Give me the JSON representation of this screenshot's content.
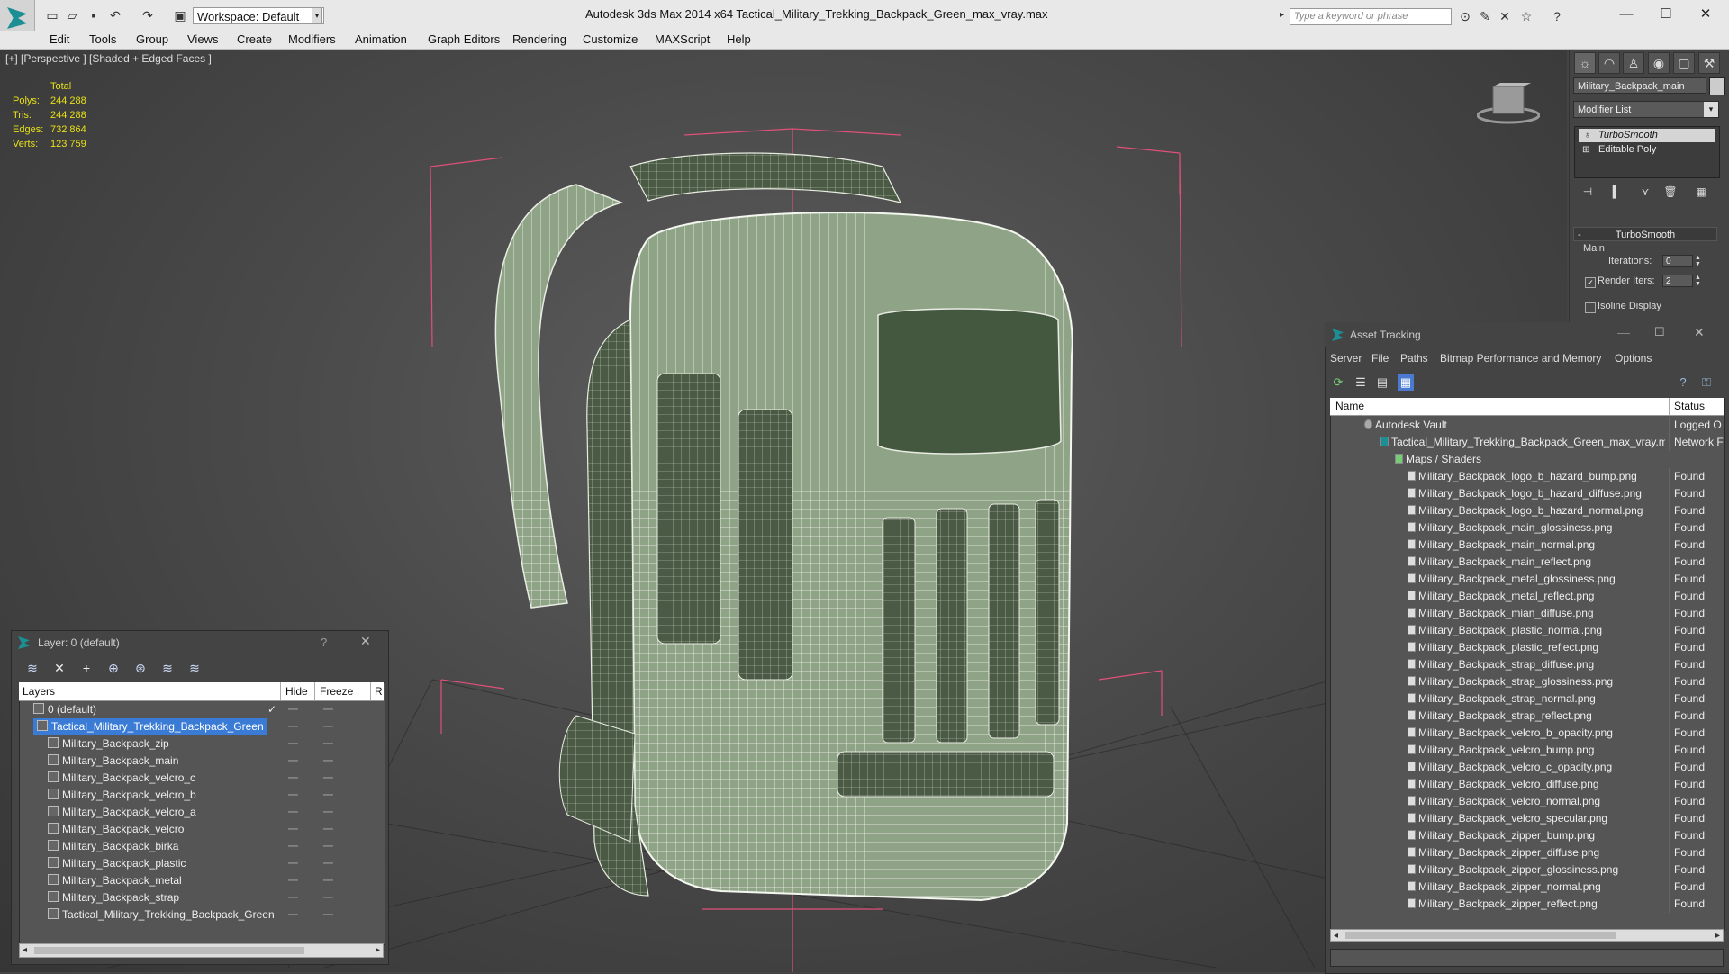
{
  "app": {
    "title": "Autodesk 3ds Max  2014 x64      Tactical_Military_Trekking_Backpack_Green_max_vray.max",
    "workspace": "Workspace: Default",
    "search_placeholder": "Type a keyword or phrase"
  },
  "menu": [
    "Edit",
    "Tools",
    "Group",
    "Views",
    "Create",
    "Modifiers",
    "Animation",
    "Graph Editors",
    "Rendering",
    "Customize",
    "MAXScript",
    "Help"
  ],
  "viewport": {
    "label": "[+] [Perspective ] [Shaded + Edged Faces ]",
    "stats_header": "Total",
    "stats": [
      {
        "label": "Polys:",
        "value": "244 288"
      },
      {
        "label": "Tris:",
        "value": "244 288"
      },
      {
        "label": "Edges:",
        "value": "732 864"
      },
      {
        "label": "Verts:",
        "value": "123 759"
      }
    ]
  },
  "command_panel": {
    "object_name": "Military_Backpack_main",
    "modifier_list": "Modifier List",
    "stack": [
      "TurboSmooth",
      "Editable Poly"
    ],
    "rollout_title": "TurboSmooth",
    "main_label": "Main",
    "iterations_label": "Iterations:",
    "iterations_value": "0",
    "render_iters_label": "Render Iters:",
    "render_iters_value": "2",
    "isoline_label": "Isoline Display"
  },
  "asset_tracking": {
    "title": "Asset Tracking",
    "menu": [
      "Server",
      "File",
      "Paths",
      "Bitmap Performance and Memory",
      "Options"
    ],
    "columns": {
      "name": "Name",
      "status": "Status"
    },
    "rows": [
      {
        "name": "Autodesk Vault",
        "status": "Logged O",
        "level": 0
      },
      {
        "name": "Tactical_Military_Trekking_Backpack_Green_max_vray.max",
        "status": "Network F",
        "level": 1
      },
      {
        "name": "Maps / Shaders",
        "status": "",
        "level": 2
      },
      {
        "name": "Military_Backpack_logo_b_hazard_bump.png",
        "status": "Found",
        "level": 3
      },
      {
        "name": "Military_Backpack_logo_b_hazard_diffuse.png",
        "status": "Found",
        "level": 3
      },
      {
        "name": "Military_Backpack_logo_b_hazard_normal.png",
        "status": "Found",
        "level": 3
      },
      {
        "name": "Military_Backpack_main_glossiness.png",
        "status": "Found",
        "level": 3
      },
      {
        "name": "Military_Backpack_main_normal.png",
        "status": "Found",
        "level": 3
      },
      {
        "name": "Military_Backpack_main_reflect.png",
        "status": "Found",
        "level": 3
      },
      {
        "name": "Military_Backpack_metal_glossiness.png",
        "status": "Found",
        "level": 3
      },
      {
        "name": "Military_Backpack_metal_reflect.png",
        "status": "Found",
        "level": 3
      },
      {
        "name": "Military_Backpack_mian_diffuse.png",
        "status": "Found",
        "level": 3
      },
      {
        "name": "Military_Backpack_plastic_normal.png",
        "status": "Found",
        "level": 3
      },
      {
        "name": "Military_Backpack_plastic_reflect.png",
        "status": "Found",
        "level": 3
      },
      {
        "name": "Military_Backpack_strap_diffuse.png",
        "status": "Found",
        "level": 3
      },
      {
        "name": "Military_Backpack_strap_glossiness.png",
        "status": "Found",
        "level": 3
      },
      {
        "name": "Military_Backpack_strap_normal.png",
        "status": "Found",
        "level": 3
      },
      {
        "name": "Military_Backpack_strap_reflect.png",
        "status": "Found",
        "level": 3
      },
      {
        "name": "Military_Backpack_velcro_b_opacity.png",
        "status": "Found",
        "level": 3
      },
      {
        "name": "Military_Backpack_velcro_bump.png",
        "status": "Found",
        "level": 3
      },
      {
        "name": "Military_Backpack_velcro_c_opacity.png",
        "status": "Found",
        "level": 3
      },
      {
        "name": "Military_Backpack_velcro_diffuse.png",
        "status": "Found",
        "level": 3
      },
      {
        "name": "Military_Backpack_velcro_normal.png",
        "status": "Found",
        "level": 3
      },
      {
        "name": "Military_Backpack_velcro_specular.png",
        "status": "Found",
        "level": 3
      },
      {
        "name": "Military_Backpack_zipper_bump.png",
        "status": "Found",
        "level": 3
      },
      {
        "name": "Military_Backpack_zipper_diffuse.png",
        "status": "Found",
        "level": 3
      },
      {
        "name": "Military_Backpack_zipper_glossiness.png",
        "status": "Found",
        "level": 3
      },
      {
        "name": "Military_Backpack_zipper_normal.png",
        "status": "Found",
        "level": 3
      },
      {
        "name": "Military_Backpack_zipper_reflect.png",
        "status": "Found",
        "level": 3
      }
    ]
  },
  "layer_window": {
    "title": "Layer: 0 (default)",
    "help": "?",
    "columns": {
      "layers": "Layers",
      "hide": "Hide",
      "freeze": "Freeze",
      "r": "R"
    },
    "rows": [
      {
        "name": "0 (default)",
        "level": 0,
        "selected": false,
        "check": "✓"
      },
      {
        "name": "Tactical_Military_Trekking_Backpack_Green",
        "level": 0,
        "selected": true,
        "check": ""
      },
      {
        "name": "Military_Backpack_zip",
        "level": 1,
        "selected": false,
        "check": ""
      },
      {
        "name": "Military_Backpack_main",
        "level": 1,
        "selected": false,
        "check": ""
      },
      {
        "name": "Military_Backpack_velcro_c",
        "level": 1,
        "selected": false,
        "check": ""
      },
      {
        "name": "Military_Backpack_velcro_b",
        "level": 1,
        "selected": false,
        "check": ""
      },
      {
        "name": "Military_Backpack_velcro_a",
        "level": 1,
        "selected": false,
        "check": ""
      },
      {
        "name": "Military_Backpack_velcro",
        "level": 1,
        "selected": false,
        "check": ""
      },
      {
        "name": "Military_Backpack_birka",
        "level": 1,
        "selected": false,
        "check": ""
      },
      {
        "name": "Military_Backpack_plastic",
        "level": 1,
        "selected": false,
        "check": ""
      },
      {
        "name": "Military_Backpack_metal",
        "level": 1,
        "selected": false,
        "check": ""
      },
      {
        "name": "Military_Backpack_strap",
        "level": 1,
        "selected": false,
        "check": ""
      },
      {
        "name": "Tactical_Military_Trekking_Backpack_Green",
        "level": 1,
        "selected": false,
        "check": ""
      }
    ]
  },
  "colors": {
    "stats_text": "#e8e018",
    "selection": "#3a7bd5",
    "bbox_lines": "#e0507a",
    "accent": "#1c8f95"
  }
}
